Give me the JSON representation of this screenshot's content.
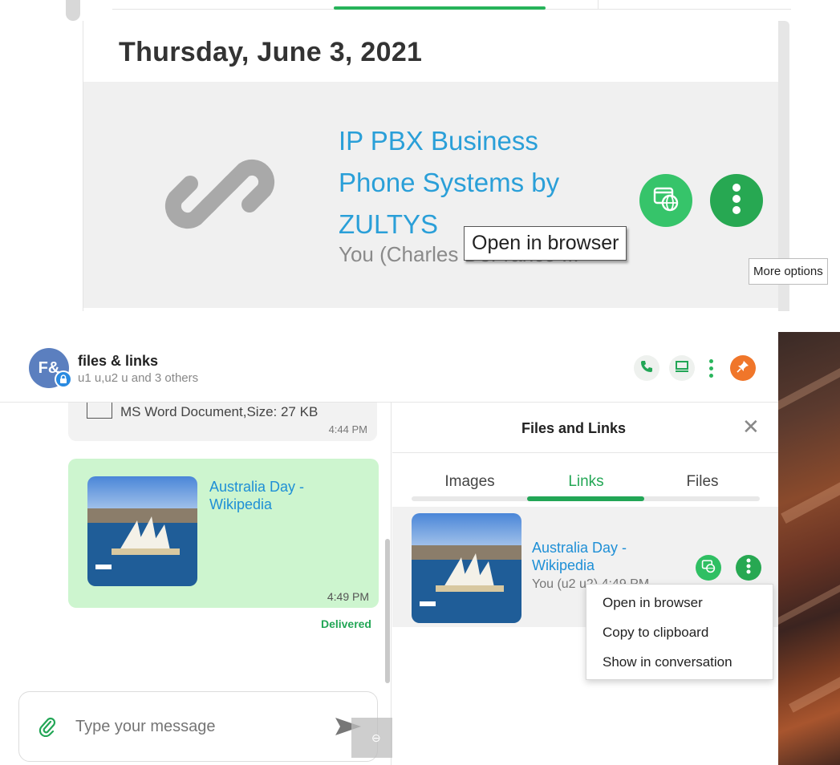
{
  "top_panel": {
    "date": "Thursday, June 3, 2021",
    "link_title": "IP PBX Business Phone Systems by ZULTYS",
    "link_sub": "You (Charles DeFranco ...",
    "tooltip": "Open in browser",
    "icons": {
      "link": "link-icon",
      "open": "browser-globe-icon",
      "more": "more-vertical-icon"
    }
  },
  "header": {
    "avatar_initials": "F&",
    "title": "files & links",
    "subtitle": "u1 u,u2 u and 3 others",
    "icons": [
      "call-icon",
      "screen-share-icon",
      "more-vertical-icon",
      "pin-icon"
    ]
  },
  "chat": {
    "file_message": {
      "text": "MS Word Document,Size: 27 KB",
      "time": "4:44 PM"
    },
    "link_message": {
      "title": "Australia Day - Wikipedia",
      "time": "4:49 PM",
      "status": "Delivered"
    },
    "compose": {
      "placeholder": "Type your message"
    }
  },
  "files_panel": {
    "title": "Files and Links",
    "close": "✕",
    "tabs": [
      {
        "label": "Images",
        "active": false
      },
      {
        "label": "Links",
        "active": true
      },
      {
        "label": "Files",
        "active": false
      }
    ],
    "link_row": {
      "title": "Australia Day - Wikipedia",
      "sub": "You (u2 u2) 4:49 PM"
    },
    "context_menu": [
      "Open in browser",
      "Copy to clipboard",
      "Show in conversation"
    ],
    "tooltip": "More options"
  },
  "colors": {
    "accent_green": "#22a656",
    "link_blue": "#1e8fd6",
    "bubble_green": "#cdf5cf",
    "pin_orange": "#f0762a"
  }
}
